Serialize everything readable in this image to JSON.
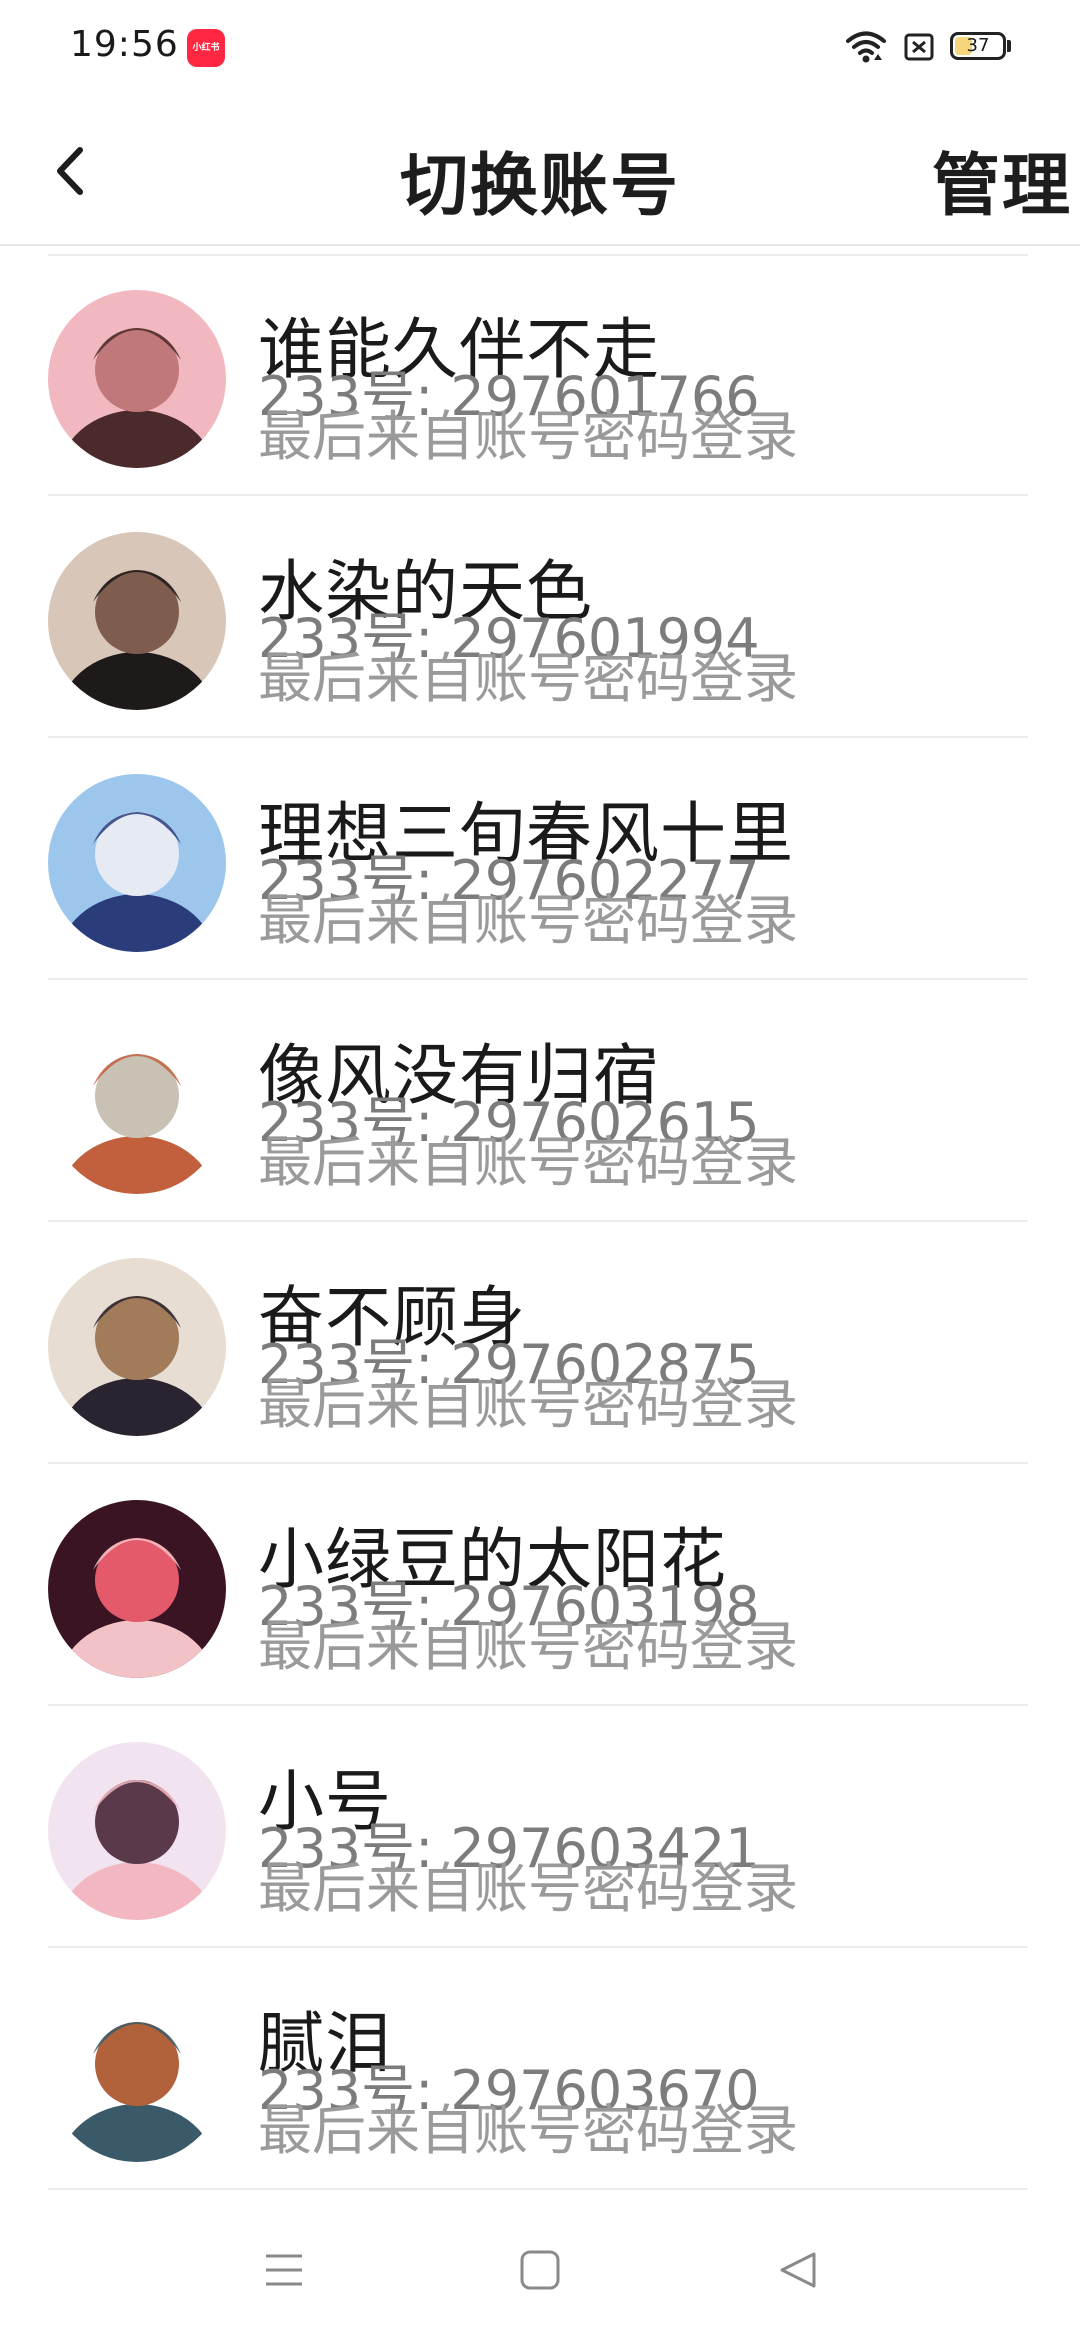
{
  "status_bar": {
    "time": "19:56",
    "app_badge_text": "小红书",
    "battery_level": "37",
    "battery_fraction": 0.37
  },
  "header": {
    "back_icon": "chevron-left-icon",
    "title": "切换账号",
    "action_label": "管理"
  },
  "accounts": [
    {
      "name": "谁能久伴不走",
      "id_line": "233号: 297601766",
      "hint": "最后来自账号密码登录",
      "avatar_colors": [
        "#f2b8c0",
        "#c0787a",
        "#4a2a2a"
      ]
    },
    {
      "name": "水染的天色",
      "id_line": "233号: 297601994",
      "hint": "最后来自账号密码登录",
      "avatar_colors": [
        "#d8c6b8",
        "#7e5d4f",
        "#1e1a1a"
      ]
    },
    {
      "name": "理想三旬春风十里",
      "id_line": "233号: 297602277",
      "hint": "最后来自账号密码登录",
      "avatar_colors": [
        "#9cc6ec",
        "#e6eaf3",
        "#2a3c7a"
      ]
    },
    {
      "name": "像风没有归宿",
      "id_line": "233号: 297602615",
      "hint": "最后来自账号密码登录",
      "avatar_colors": [
        "#ffffff",
        "#c9c1b4",
        "#c2603e"
      ]
    },
    {
      "name": "奋不顾身",
      "id_line": "233号: 297602875",
      "hint": "最后来自账号密码登录",
      "avatar_colors": [
        "#e7ddd2",
        "#a27b5a",
        "#2a2430"
      ]
    },
    {
      "name": "小绿豆的太阳花",
      "id_line": "233号: 297603198",
      "hint": "最后来自账号密码登录",
      "avatar_colors": [
        "#3b1424",
        "#e45a6a",
        "#f2c2c6"
      ]
    },
    {
      "name": "小号",
      "id_line": "233号: 297603421",
      "hint": "最后来自账号密码登录",
      "avatar_colors": [
        "#f1e3ef",
        "#5a3a4a",
        "#f3b7c2"
      ]
    },
    {
      "name": "腻泪",
      "id_line": "233号: 297603670",
      "hint": "最后来自账号密码登录",
      "avatar_colors": [
        "#ffffff",
        "#b2623a",
        "#3a5a6a"
      ]
    }
  ],
  "system_nav": {
    "menu_icon": "menu-icon",
    "home_icon": "home-square-icon",
    "back_icon": "back-triangle-icon"
  }
}
